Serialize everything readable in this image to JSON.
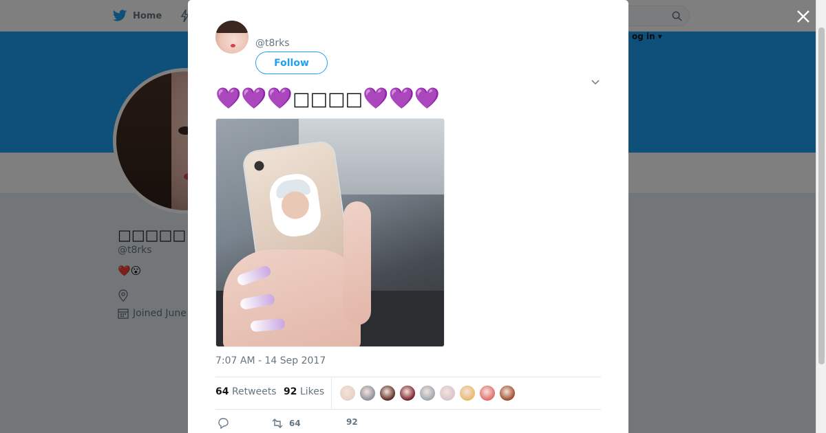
{
  "nav": {
    "home_label": "Home"
  },
  "header": {
    "login_label": "og in ▾"
  },
  "profile": {
    "display_name": "□□□□□",
    "handle": "@t8rks",
    "bio_emojis": "❤️😮",
    "joined": "Joined June"
  },
  "tweet": {
    "author_handle": "@t8rks",
    "follow_label": "Follow",
    "text_hearts_left": "💜💜💜",
    "text_middle": "□□□□",
    "text_hearts_right": "💜💜💜",
    "photo_caption": "iPhone",
    "timestamp": "7:07 AM - 14 Sep 2017",
    "retweets_count": "64",
    "retweets_label": "Retweets",
    "likes_count": "92",
    "likes_label": "Likes",
    "likers": [
      {
        "color": "#e8cfc4"
      },
      {
        "color": "#8b8f99"
      },
      {
        "color": "#5a2a1f"
      },
      {
        "color": "#7a1e2a"
      },
      {
        "color": "#9aa7b1"
      },
      {
        "color": "#d8c3cf"
      },
      {
        "color": "#e8b86a"
      },
      {
        "color": "#e06a6a"
      },
      {
        "color": "#a04a2a"
      }
    ],
    "actions": {
      "reply_count": "",
      "retweet_count": "64",
      "like_count": "92"
    }
  },
  "colors": {
    "brand": "#1da1f2",
    "heart_purple": "#9b6bd6",
    "muted": "#66757f"
  }
}
